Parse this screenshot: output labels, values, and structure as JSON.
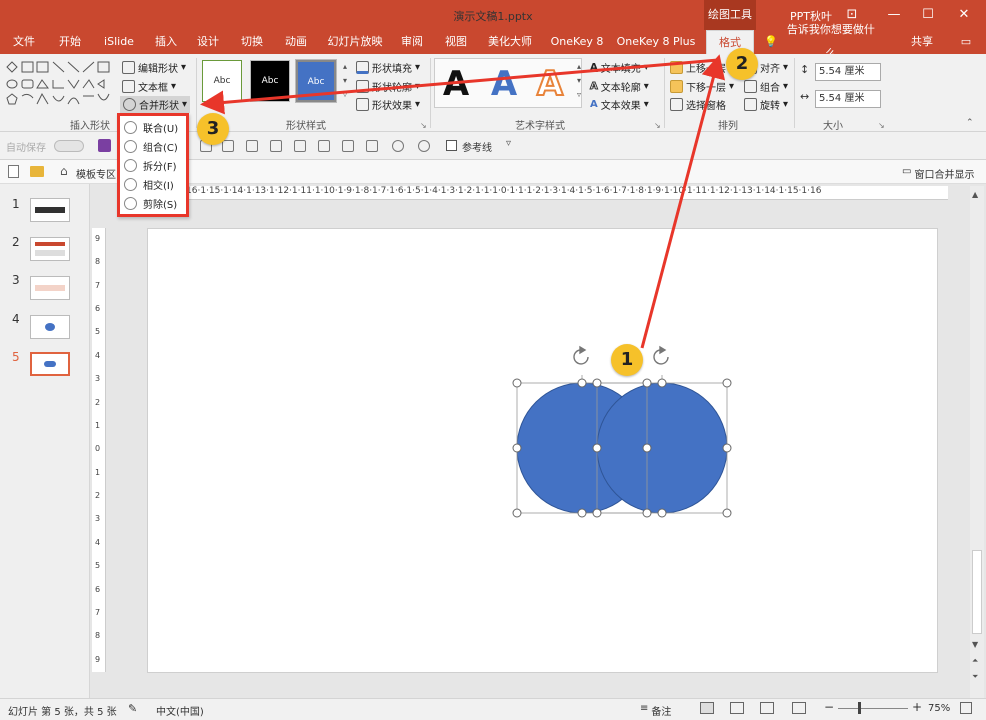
{
  "window": {
    "title": "演示文稿1.pptx",
    "context_tab": "绘图工具",
    "user": "PPT秋叶",
    "controls": {
      "restore": "⊡",
      "minimize": "—",
      "maximize": "☐",
      "close": "✕"
    }
  },
  "tabs": [
    {
      "label": "文件",
      "id": "file"
    },
    {
      "label": "开始",
      "id": "home"
    },
    {
      "label": "iSlide",
      "id": "islide"
    },
    {
      "label": "插入",
      "id": "insert"
    },
    {
      "label": "设计",
      "id": "design"
    },
    {
      "label": "切换",
      "id": "transitions"
    },
    {
      "label": "动画",
      "id": "animations"
    },
    {
      "label": "幻灯片放映",
      "id": "slideshow"
    },
    {
      "label": "审阅",
      "id": "review"
    },
    {
      "label": "视图",
      "id": "view"
    },
    {
      "label": "美化大师",
      "id": "meihua"
    },
    {
      "label": "OneKey 8",
      "id": "onekey8"
    },
    {
      "label": "OneKey 8 Plus",
      "id": "onekey8plus"
    },
    {
      "label": "格式",
      "id": "format"
    }
  ],
  "tellme": "告诉我你想要做什么",
  "share": "共享",
  "ribbon": {
    "insert_shapes": {
      "label": "插入形状",
      "edit_shape": "编辑形状",
      "text_box": "文本框",
      "merge_shapes": "合并形状"
    },
    "shape_styles": {
      "label": "形状样式",
      "style_sample": "Abc",
      "fill": "形状填充",
      "outline": "形状轮廓",
      "effects": "形状效果"
    },
    "wordart": {
      "label": "艺术字样式",
      "sample": "A",
      "text_fill": "文本填充",
      "text_outline": "文本轮廓",
      "text_effects": "文本效果"
    },
    "arrange": {
      "label": "排列",
      "bring_forward": "上移一层",
      "send_backward": "下移一层",
      "selection_pane": "选择窗格",
      "align": "对齐",
      "group": "组合",
      "rotate": "旋转"
    },
    "size": {
      "label": "大小",
      "height": "5.54 厘米",
      "width": "5.54 厘米"
    }
  },
  "qat": {
    "autosave": "自动保存",
    "guides": "参考线"
  },
  "crumb": {
    "template": "模板专区",
    "window_merge": "窗口合并显示"
  },
  "dropdown": {
    "items": [
      {
        "label": "联合(U)",
        "id": "union"
      },
      {
        "label": "组合(C)",
        "id": "combine"
      },
      {
        "label": "拆分(F)",
        "id": "fragment"
      },
      {
        "label": "相交(I)",
        "id": "intersect"
      },
      {
        "label": "剪除(S)",
        "id": "subtract"
      }
    ]
  },
  "slides": [
    {
      "num": "1"
    },
    {
      "num": "2"
    },
    {
      "num": "3"
    },
    {
      "num": "4"
    },
    {
      "num": "5",
      "active": true
    }
  ],
  "ruler": {
    "h": "16·1·15·1·14·1·13·1·12·1·11·1·10·1·9·1·8·1·7·1·6·1·5·1·4·1·3·1·2·1·1·1·0·1·1·1·2·1·3·1·4·1·5·1·6·1·7·1·8·1·9·1·10·1·11·1·12·1·13·1·14·1·15·1·16",
    "v": [
      "9",
      "8",
      "7",
      "6",
      "5",
      "4",
      "3",
      "2",
      "1",
      "0",
      "1",
      "2",
      "3",
      "4",
      "5",
      "6",
      "7",
      "8",
      "9"
    ]
  },
  "badges": {
    "one": "1",
    "two": "2",
    "three": "3"
  },
  "status": {
    "slide_info": "幻灯片 第 5 张，共 5 张",
    "language": "中文(中国)",
    "notes": "备注",
    "zoom": "75%"
  },
  "colors": {
    "accent": "#c9482f",
    "circle": "#4472c4",
    "callout": "#e8362a",
    "badge": "#f6c12a"
  }
}
